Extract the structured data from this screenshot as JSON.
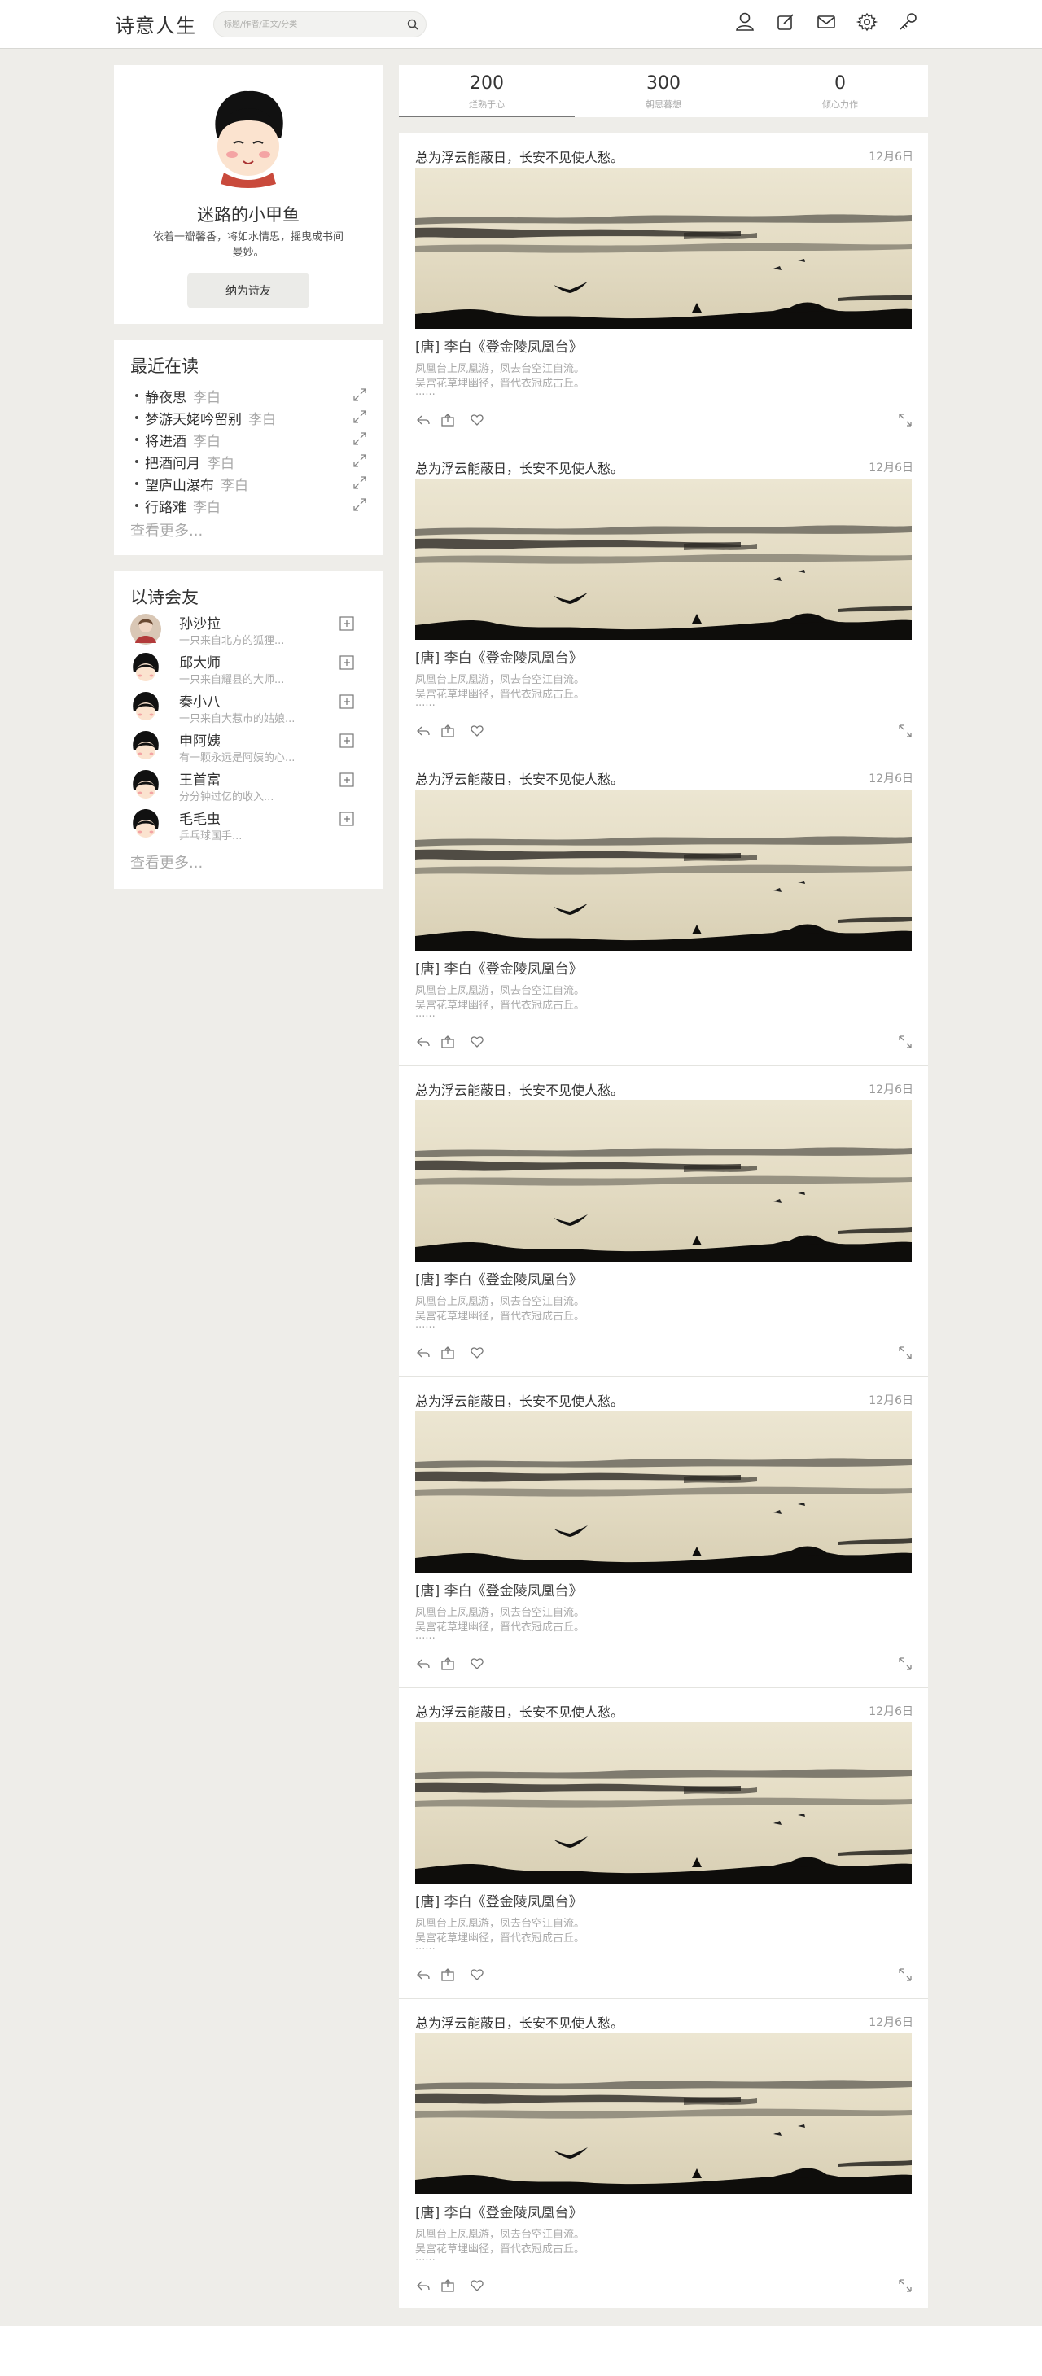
{
  "app": {
    "logo": "诗意人生"
  },
  "search": {
    "placeholder": "标题/作者/正文/分类"
  },
  "header_icons": [
    "user-icon",
    "edit-icon",
    "mail-icon",
    "settings-icon",
    "key-icon"
  ],
  "profile": {
    "name": "迷路的小甲鱼",
    "bio": "依着一瓣馨香，将如水情思，摇曳成书间曼妙。",
    "follow_label": "纳为诗友"
  },
  "recent": {
    "title": "最近在读",
    "items": [
      {
        "title": "静夜思",
        "author": "李白"
      },
      {
        "title": "梦游天姥吟留别",
        "author": "李白"
      },
      {
        "title": "将进酒",
        "author": "李白"
      },
      {
        "title": "把酒问月",
        "author": "李白"
      },
      {
        "title": "望庐山瀑布",
        "author": "李白"
      },
      {
        "title": "行路难",
        "author": "李白"
      }
    ],
    "more": "查看更多..."
  },
  "friends": {
    "title": "以诗会友",
    "items": [
      {
        "name": "孙沙拉",
        "desc": "一只来自北方的狐狸..."
      },
      {
        "name": "邱大师",
        "desc": "一只来自耀县的大师..."
      },
      {
        "name": "秦小八",
        "desc": "一只来自大惹市的姑娘..."
      },
      {
        "name": "申阿姨",
        "desc": "有一颗永远是阿姨的心..."
      },
      {
        "name": "王首富",
        "desc": "分分钟过亿的收入..."
      },
      {
        "name": "毛毛虫",
        "desc": "乒乓球国手..."
      }
    ],
    "more": "查看更多..."
  },
  "tabs": [
    {
      "count": "200",
      "label": "烂熟于心"
    },
    {
      "count": "300",
      "label": "朝思暮想"
    },
    {
      "count": "0",
      "label": "倾心力作"
    }
  ],
  "posts": [
    {
      "quote": "总为浮云能蔽日，长安不见使人愁。",
      "date": "12月6日",
      "source": "[唐] 李白《登金陵凤凰台》",
      "line1": "凤凰台上凤凰游，凤去台空江自流。",
      "line2": "吴宫花草埋幽径，晋代衣冠成古丘。",
      "ellipsis": "......"
    },
    {
      "quote": "总为浮云能蔽日，长安不见使人愁。",
      "date": "12月6日",
      "source": "[唐] 李白《登金陵凤凰台》",
      "line1": "凤凰台上凤凰游，凤去台空江自流。",
      "line2": "吴宫花草埋幽径，晋代衣冠成古丘。",
      "ellipsis": "......"
    },
    {
      "quote": "总为浮云能蔽日，长安不见使人愁。",
      "date": "12月6日",
      "source": "[唐] 李白《登金陵凤凰台》",
      "line1": "凤凰台上凤凰游，凤去台空江自流。",
      "line2": "吴宫花草埋幽径，晋代衣冠成古丘。",
      "ellipsis": "......"
    },
    {
      "quote": "总为浮云能蔽日，长安不见使人愁。",
      "date": "12月6日",
      "source": "[唐] 李白《登金陵凤凰台》",
      "line1": "凤凰台上凤凰游，凤去台空江自流。",
      "line2": "吴宫花草埋幽径，晋代衣冠成古丘。",
      "ellipsis": "......"
    },
    {
      "quote": "总为浮云能蔽日，长安不见使人愁。",
      "date": "12月6日",
      "source": "[唐] 李白《登金陵凤凰台》",
      "line1": "凤凰台上凤凰游，凤去台空江自流。",
      "line2": "吴宫花草埋幽径，晋代衣冠成古丘。",
      "ellipsis": "......"
    },
    {
      "quote": "总为浮云能蔽日，长安不见使人愁。",
      "date": "12月6日",
      "source": "[唐] 李白《登金陵凤凰台》",
      "line1": "凤凰台上凤凰游，凤去台空江自流。",
      "line2": "吴宫花草埋幽径，晋代衣冠成古丘。",
      "ellipsis": "......"
    },
    {
      "quote": "总为浮云能蔽日，长安不见使人愁。",
      "date": "12月6日",
      "source": "[唐] 李白《登金陵凤凰台》",
      "line1": "凤凰台上凤凰游，凤去台空江自流。",
      "line2": "吴宫花草埋幽径，晋代衣冠成古丘。",
      "ellipsis": "......"
    }
  ],
  "post_icons": [
    "reply-icon",
    "share-icon",
    "heart-icon",
    "expand-icon"
  ],
  "colors": {
    "page_bg": "#eeede9",
    "card_bg": "#ffffff",
    "ink": "#111111",
    "paper": "#e9e2cd"
  }
}
